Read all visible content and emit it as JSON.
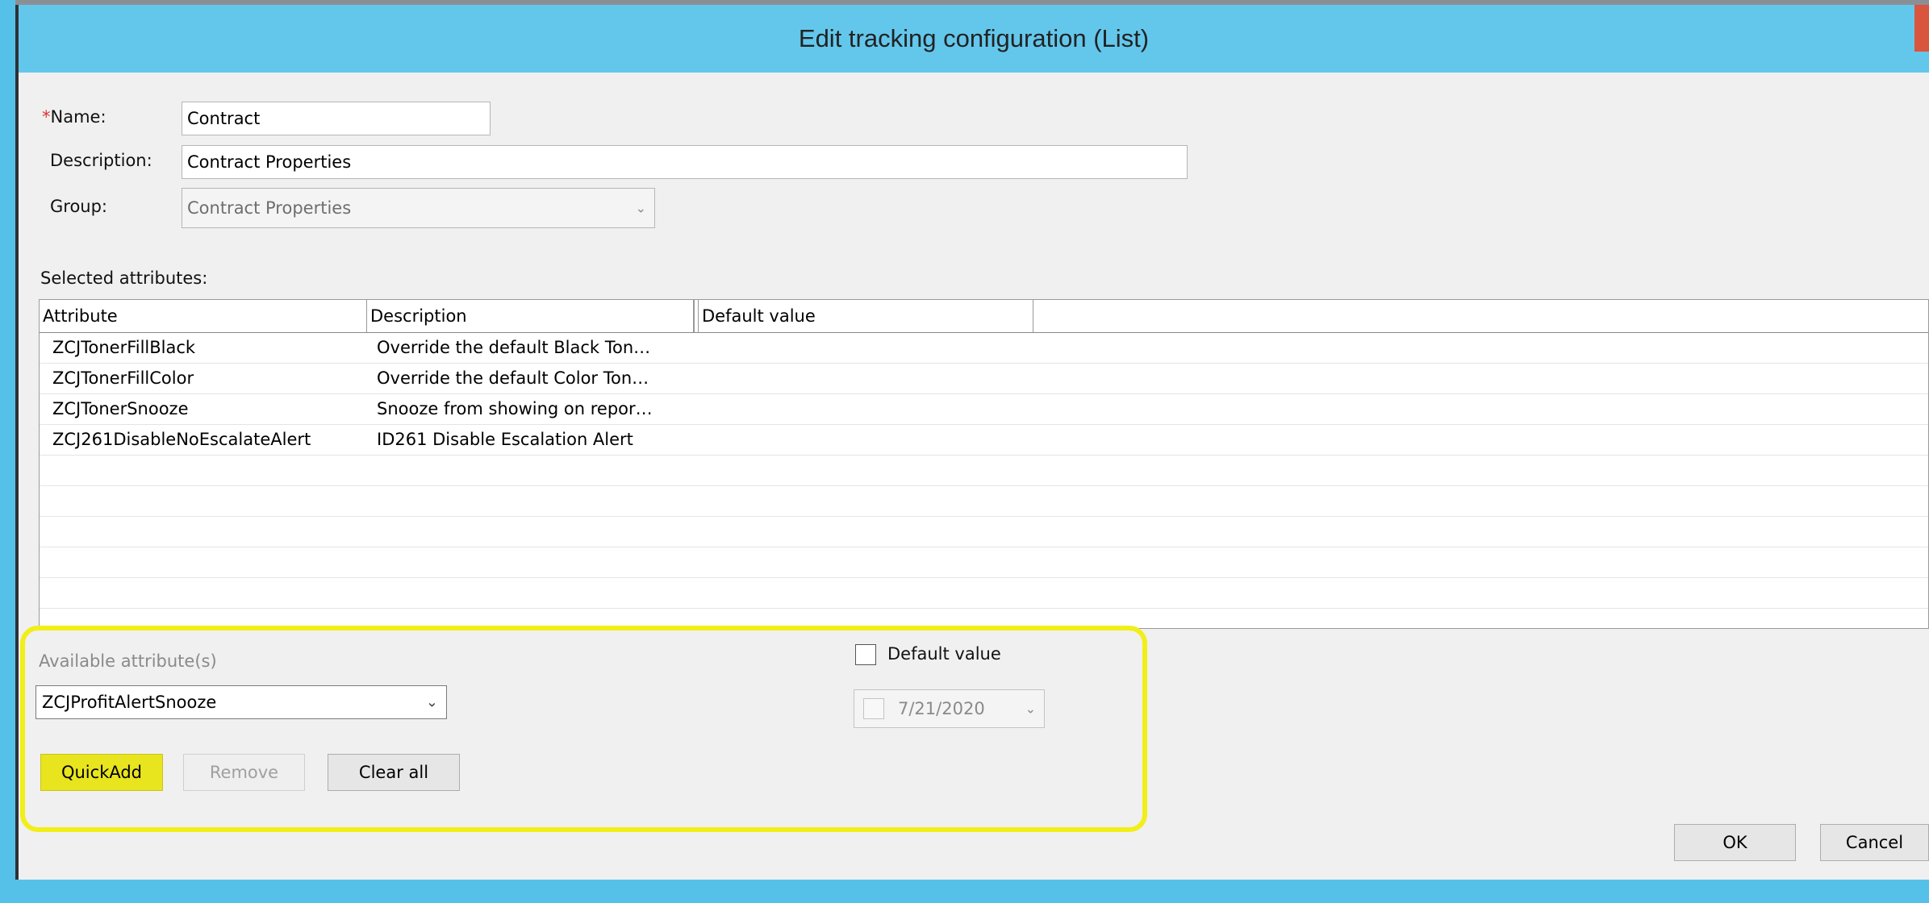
{
  "window": {
    "title": "Edit tracking configuration (List)"
  },
  "form": {
    "required_marker": "*",
    "name_label": "Name:",
    "name_value": "Contract",
    "description_label": "Description:",
    "description_value": "Contract Properties",
    "group_label": "Group:",
    "group_value": "Contract Properties"
  },
  "selected_attributes": {
    "label": "Selected attributes:",
    "columns": [
      "Attribute",
      "Description",
      "Default value"
    ],
    "rows": [
      {
        "attribute": "ZCJTonerFillBlack",
        "description": "Override the default Black Ton…"
      },
      {
        "attribute": "ZCJTonerFillColor",
        "description": "Override the default Color Ton…"
      },
      {
        "attribute": "ZCJTonerSnooze",
        "description": "Snooze from showing on repor…"
      },
      {
        "attribute": "ZCJ261DisableNoEscalateAlert",
        "description": "ID261 Disable Escalation Alert"
      }
    ]
  },
  "available": {
    "label": "Available attribute(s)",
    "selected": "ZCJProfitAlertSnooze",
    "default_value_label": "Default value",
    "default_value_checked": false,
    "date_value": "7/21/2020"
  },
  "buttons": {
    "quickadd": "QuickAdd",
    "remove": "Remove",
    "clear_all": "Clear all",
    "ok": "OK",
    "cancel": "Cancel"
  },
  "colors": {
    "titlebar": "#63c7ec",
    "highlight": "#f2ee19",
    "required": "#e23131"
  },
  "icons": {
    "dropdown": "chevron-down-icon",
    "checkbox": "checkbox-icon"
  }
}
